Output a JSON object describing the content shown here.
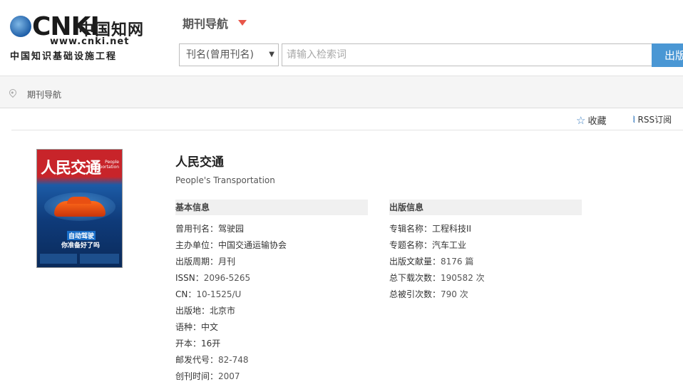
{
  "header": {
    "logo": {
      "brand": "CNKI",
      "cn_name": "中国知网",
      "url_text": "www.cnki.net",
      "subtitle": "中国知识基础设施工程"
    },
    "nav_title": "期刊导航",
    "search": {
      "field_selected": "刊名(曾用刊名)",
      "placeholder": "请输入检索词",
      "button_label": "出版"
    }
  },
  "breadcrumb": {
    "label": "期刊导航"
  },
  "actions": {
    "favorite_label": "收藏",
    "rss_label": "RSS订阅"
  },
  "cover": {
    "title": "人民交通",
    "en_lines": [
      "People",
      "Transportation"
    ],
    "headline1": "自动驾驶",
    "headline2": "你准备好了吗"
  },
  "journal": {
    "title_cn": "人民交通",
    "title_en": "People's Transportation"
  },
  "basic_info": {
    "heading": "基本信息",
    "rows": [
      {
        "label": "曾用刊名：",
        "value": "驾驶园"
      },
      {
        "label": "主办单位：",
        "value": "中国交通运输协会"
      },
      {
        "label": "出版周期：",
        "value": "月刊"
      },
      {
        "label": "ISSN：",
        "value": "2096-5265"
      },
      {
        "label": "CN：",
        "value": "10-1525/U"
      },
      {
        "label": "出版地：",
        "value": "北京市"
      },
      {
        "label": "语种：",
        "value": "中文"
      },
      {
        "label": "开本：",
        "value": "16开"
      },
      {
        "label": "邮发代号：",
        "value": "82-748"
      },
      {
        "label": "创刊时间：",
        "value": "2007"
      }
    ]
  },
  "pub_info": {
    "heading": "出版信息",
    "rows": [
      {
        "label": "专辑名称：",
        "value": "工程科技II"
      },
      {
        "label": "专题名称：",
        "value": "汽车工业"
      },
      {
        "label": "出版文献量：",
        "value": "8176 篇"
      },
      {
        "label": "总下载次数：",
        "value": "190582 次"
      },
      {
        "label": "总被引次数：",
        "value": "790 次"
      }
    ]
  },
  "colors": {
    "accent_blue": "#4a97d4",
    "caret_red": "#e8564a",
    "icon_blue": "#3d7fc1"
  }
}
